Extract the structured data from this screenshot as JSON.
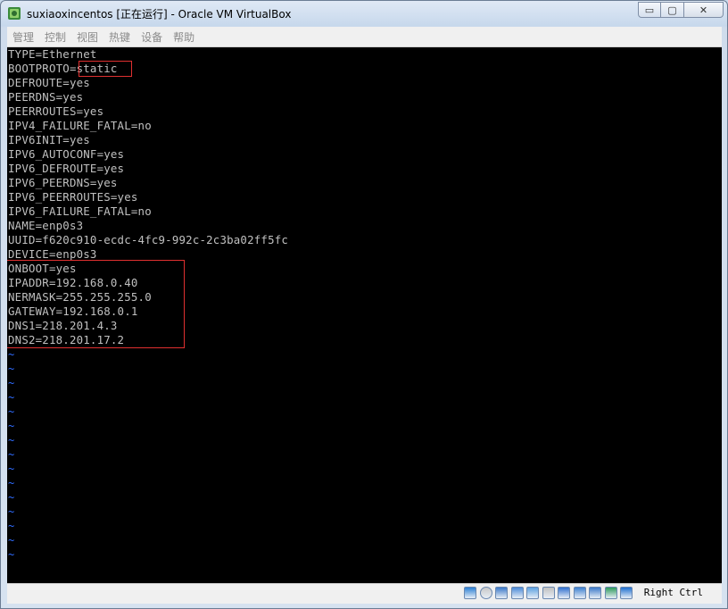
{
  "window": {
    "title": "suxiaoxincentos [正在运行] - Oracle VM VirtualBox",
    "min_glyph": "▭",
    "max_glyph": "▢",
    "close_glyph": "✕"
  },
  "menu": {
    "items": [
      "管理",
      "控制",
      "视图",
      "热键",
      "设备",
      "帮助"
    ]
  },
  "console": {
    "lines": [
      "TYPE=Ethernet",
      "BOOTPROTO=static",
      "DEFROUTE=yes",
      "PEERDNS=yes",
      "PEERROUTES=yes",
      "IPV4_FAILURE_FATAL=no",
      "IPV6INIT=yes",
      "IPV6_AUTOCONF=yes",
      "IPV6_DEFROUTE=yes",
      "IPV6_PEERDNS=yes",
      "IPV6_PEERROUTES=yes",
      "IPV6_FAILURE_FATAL=no",
      "NAME=enp0s3",
      "UUID=f620c910-ecdc-4fc9-992c-2c3ba02ff5fc",
      "DEVICE=enp0s3",
      "ONBOOT=yes",
      "IPADDR=192.168.0.40",
      "NERMASK=255.255.255.0",
      "GATEWAY=192.168.0.1",
      "DNS1=218.201.4.3",
      "DNS2=218.201.17.2"
    ],
    "empty_line_marker": "~",
    "empty_line_count": 15,
    "text_color": "#c0c0c0",
    "tilde_color": "#2f6cff",
    "highlight_color": "#e03030"
  },
  "statusbar": {
    "icons": [
      "hard-disk-icon",
      "optical-drive-icon",
      "audio-icon",
      "network-icon",
      "usb-icon",
      "shared-folders-icon",
      "display-icon",
      "video-capture-icon",
      "virtualization-icon",
      "mouse-integration-icon",
      "keyboard-capture-icon"
    ],
    "host_key": "Right Ctrl"
  }
}
